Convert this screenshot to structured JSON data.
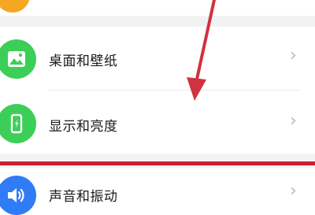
{
  "settings": {
    "items": [
      {
        "label": "桌面和壁纸",
        "icon": "wallpaper-icon",
        "icon_color": "#3ccf57"
      },
      {
        "label": "显示和亮度",
        "icon": "display-brightness-icon",
        "icon_color": "#3ccf57"
      },
      {
        "label": "声音和振动",
        "icon": "speaker-icon",
        "icon_color": "#2f7cf6"
      }
    ],
    "top_icon_color": "#f5a623",
    "chevron": "›"
  },
  "annotation": {
    "arrow_color": "#d0323e",
    "underline_color": "#c8222e"
  }
}
